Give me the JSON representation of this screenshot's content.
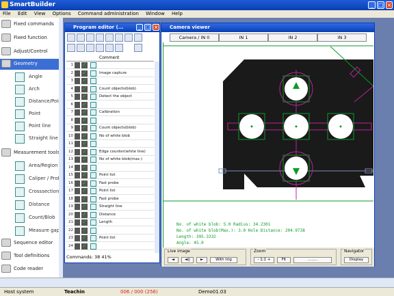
{
  "app": {
    "title": "SmartBuilder"
  },
  "menu": [
    "File",
    "Edit",
    "View",
    "Options",
    "Command administration",
    "Window",
    "Help"
  ],
  "sidebar": {
    "categories": [
      {
        "label": "Fixed commands"
      },
      {
        "label": "Fixed function"
      },
      {
        "label": "Adjust/Control"
      },
      {
        "label": "Geometry"
      },
      {
        "label": "Measurement tools"
      },
      {
        "label": "Sequence editor"
      },
      {
        "label": "Tool definitions"
      },
      {
        "label": "Code reader"
      }
    ],
    "geometry_items": [
      {
        "label": "Angle"
      },
      {
        "label": "Arch"
      },
      {
        "label": "Distance/Point"
      },
      {
        "label": "Point"
      },
      {
        "label": "Point line"
      },
      {
        "label": "Straight line"
      }
    ],
    "measure_items": [
      {
        "label": "Area/Region"
      },
      {
        "label": "Caliper / Probe"
      },
      {
        "label": "Crosssection"
      },
      {
        "label": "Distance"
      },
      {
        "label": "Count/Blob"
      },
      {
        "label": "Measure gap..."
      }
    ]
  },
  "program_editor": {
    "title": "Program editor (...",
    "column_header": "Comment",
    "rows": [
      {
        "n": "1",
        "comment": ""
      },
      {
        "n": "2",
        "comment": "Image capture"
      },
      {
        "n": "3",
        "comment": ""
      },
      {
        "n": "4",
        "comment": "Count objects(blob)"
      },
      {
        "n": "5",
        "comment": "Detect the object"
      },
      {
        "n": "6",
        "comment": ""
      },
      {
        "n": "7",
        "comment": "Calibration"
      },
      {
        "n": "8",
        "comment": ""
      },
      {
        "n": "9",
        "comment": "Count objects(blob)"
      },
      {
        "n": "10",
        "comment": "No of white blob"
      },
      {
        "n": "11",
        "comment": ""
      },
      {
        "n": "12",
        "comment": "Edge counter(white line)"
      },
      {
        "n": "13",
        "comment": "No of white blob(max.)"
      },
      {
        "n": "14",
        "comment": ""
      },
      {
        "n": "15",
        "comment": "Point list"
      },
      {
        "n": "16",
        "comment": "Fast probe"
      },
      {
        "n": "17",
        "comment": "Point list"
      },
      {
        "n": "18",
        "comment": "Fast probe"
      },
      {
        "n": "19",
        "comment": "Straight line"
      },
      {
        "n": "20",
        "comment": "Distance"
      },
      {
        "n": "21",
        "comment": "Length"
      },
      {
        "n": "22",
        "comment": ""
      },
      {
        "n": "23",
        "comment": "Point list"
      },
      {
        "n": "24",
        "comment": ""
      }
    ],
    "status": "Commands: 38   41%"
  },
  "camera_viewer": {
    "title": "Camera viewer",
    "tabs": [
      "Camera / IN 0",
      "IN 1",
      "IN 2",
      "IN 3"
    ],
    "results": [
      "No. of white blob: 5.0          Radius: 34.2301",
      "No. of white blob(Max.): 3.0    Hole Distance: 204.9738",
      "Length: 395.3332",
      "Angle: 45.0"
    ],
    "groups": {
      "live": {
        "title": "Live image",
        "buttons": [
          "◄",
          "◄||",
          "►",
          "With trig"
        ]
      },
      "zoom": {
        "title": "Zoom",
        "buttons": [
          "- 1:1 +",
          "Fit",
          "........"
        ]
      },
      "navigator": {
        "title": "Navigator",
        "buttons": [
          "Display"
        ]
      }
    }
  },
  "statusbar": {
    "mode": "Host system",
    "state": "Teachin",
    "counter": "006 / 000 (256)",
    "demo": "Demo01.03",
    "colors": {
      "counter": "#d81e1e"
    }
  }
}
